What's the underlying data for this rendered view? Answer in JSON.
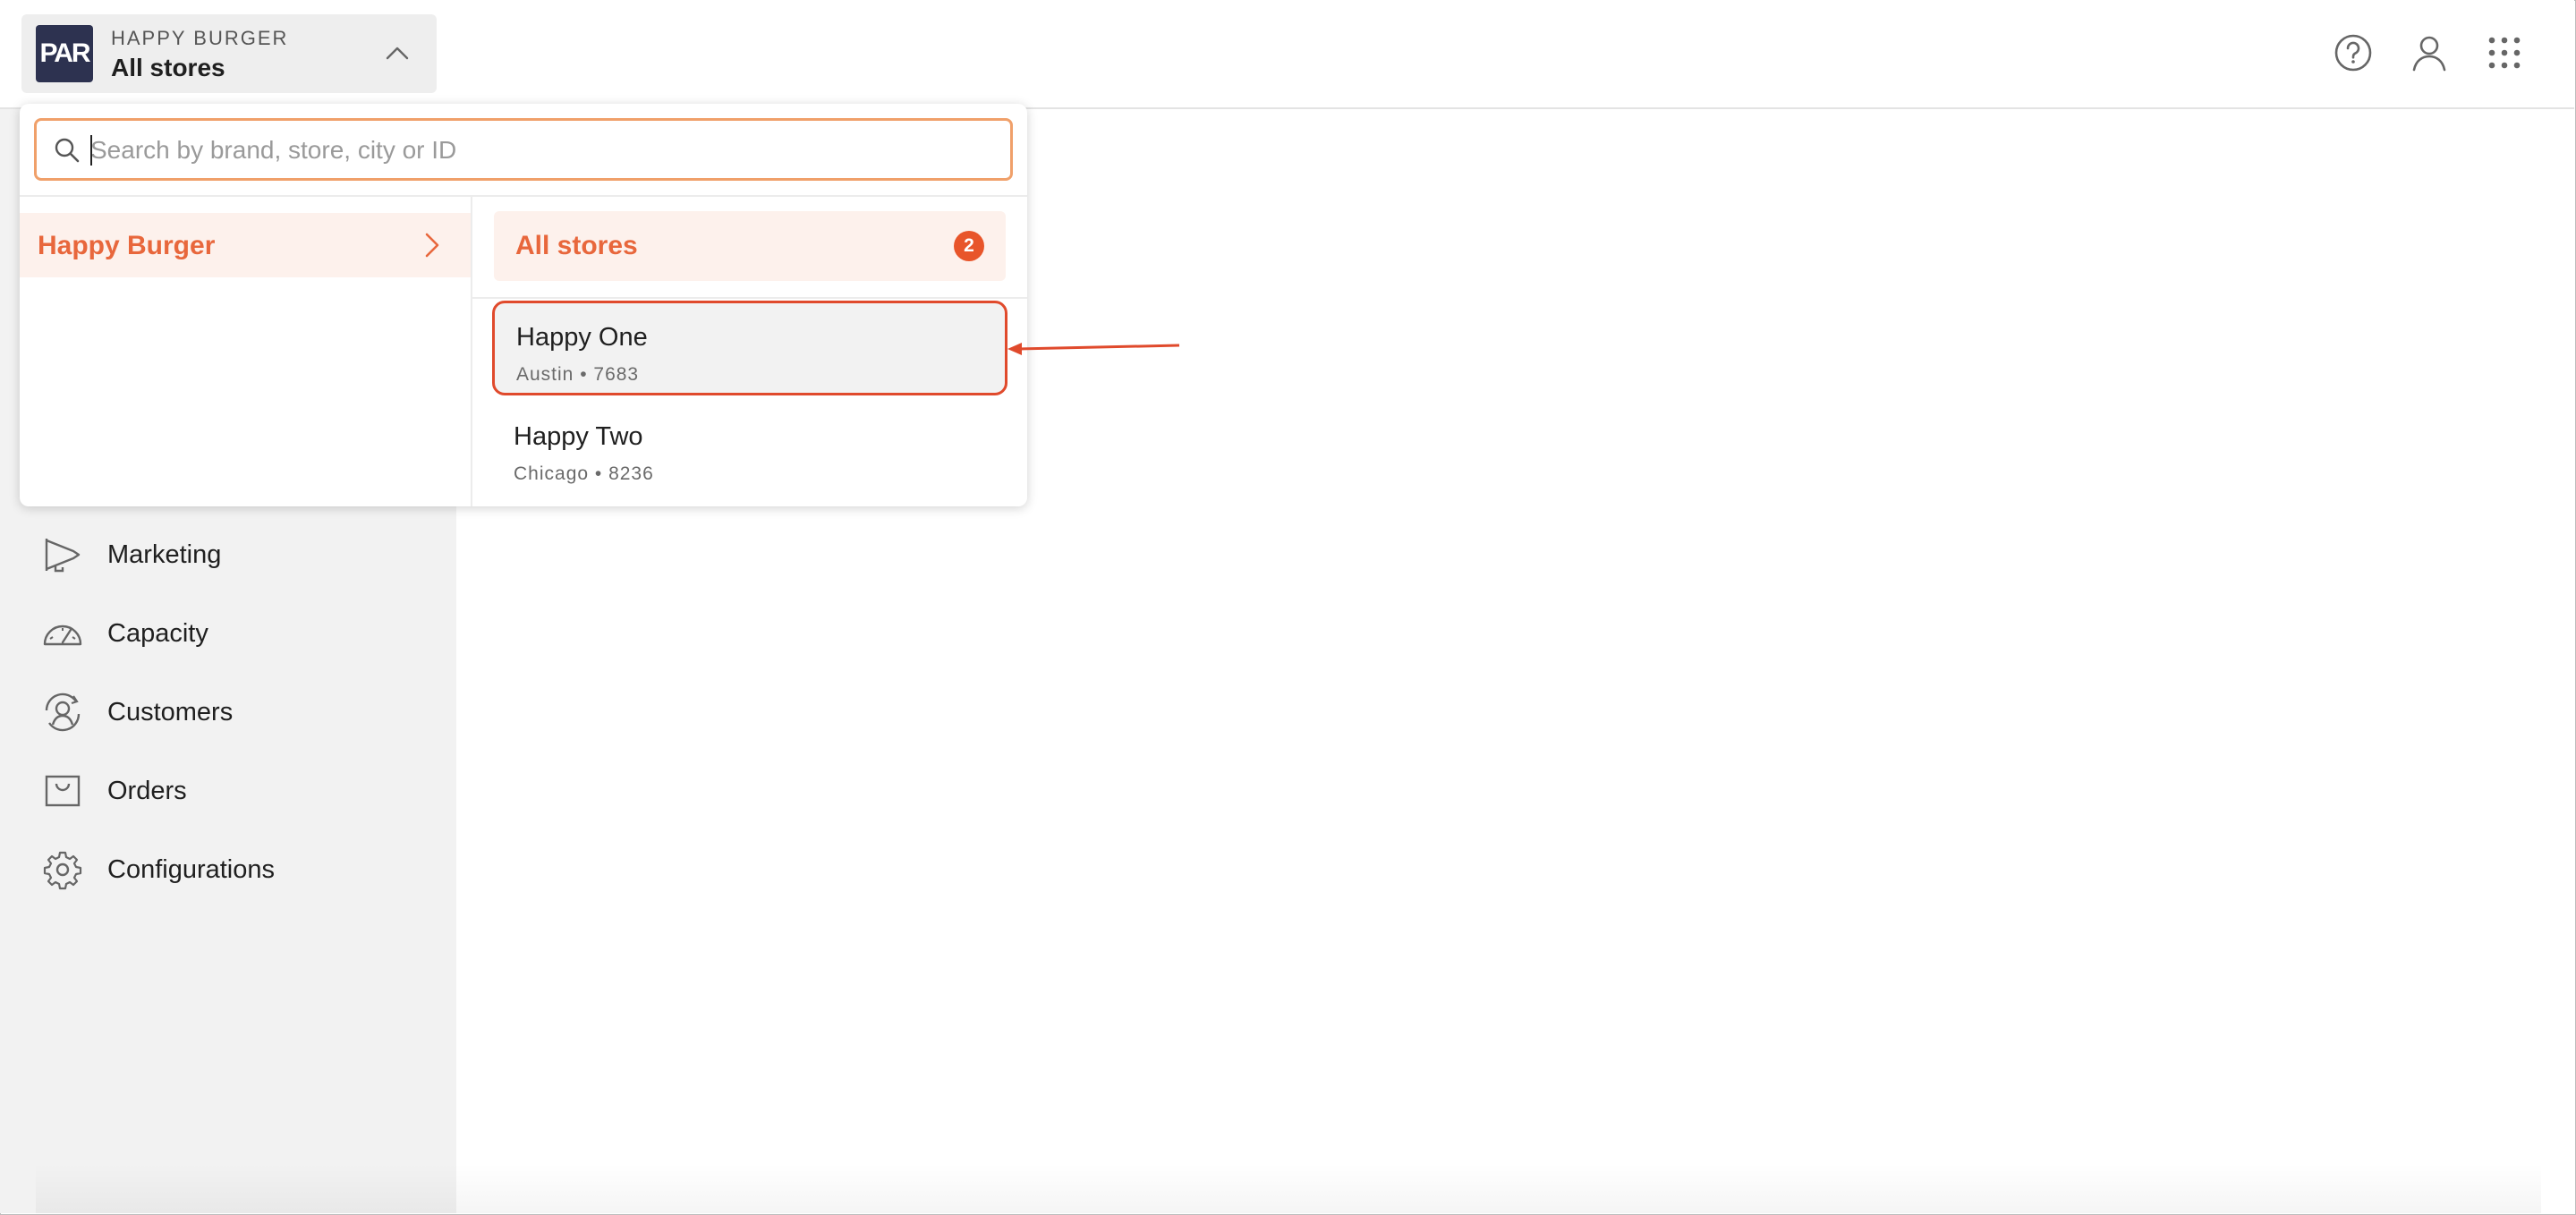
{
  "header": {
    "logo_text": "PAR",
    "brand_caption": "HAPPY BURGER",
    "store_selection": "All stores",
    "icons": [
      "chevron-up-icon",
      "help-icon",
      "user-icon",
      "app-grid-icon"
    ]
  },
  "dropdown": {
    "search": {
      "placeholder": "Search by brand, store, city or ID",
      "value": ""
    },
    "brand": {
      "name": "Happy Burger"
    },
    "all_stores": {
      "label": "All stores",
      "count": "2"
    },
    "stores": [
      {
        "name": "Happy One",
        "meta": "Austin • 7683",
        "highlighted": true
      },
      {
        "name": "Happy Two",
        "meta": "Chicago • 8236",
        "highlighted": false
      }
    ]
  },
  "sidebar": {
    "items": [
      {
        "label": "Marketing",
        "icon": "megaphone-icon"
      },
      {
        "label": "Capacity",
        "icon": "gauge-icon"
      },
      {
        "label": "Customers",
        "icon": "customers-icon"
      },
      {
        "label": "Orders",
        "icon": "bag-icon"
      },
      {
        "label": "Configurations",
        "icon": "gear-icon"
      }
    ]
  },
  "colors": {
    "accent": "#e8673c",
    "highlight_border": "#e04a2c",
    "search_border": "#f0a06a",
    "logo_bg": "#2d3250",
    "sidebar_bg": "#f2f2f2",
    "selected_bg": "#fdf1ec"
  }
}
